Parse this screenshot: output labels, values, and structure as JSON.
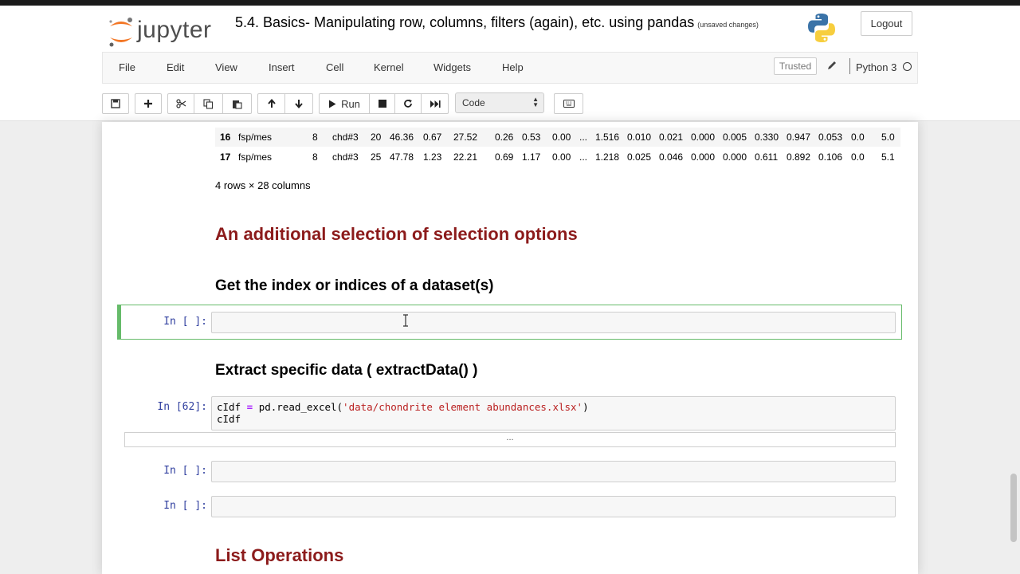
{
  "app": {
    "logo_text": "jupyter",
    "notebook_title": "5.4. Basics- Manipulating row, columns, filters (again), etc. using pandas",
    "save_status": "(unsaved changes)",
    "logout_label": "Logout"
  },
  "menu": {
    "items": [
      "File",
      "Edit",
      "View",
      "Insert",
      "Cell",
      "Kernel",
      "Widgets",
      "Help"
    ],
    "trusted_label": "Trusted",
    "kernel_name": "Python 3"
  },
  "toolbar": {
    "run_label": "Run",
    "cell_type": "Code"
  },
  "dataframe": {
    "rows": [
      [
        "16",
        "fsp/mes",
        "8",
        "chd#3",
        "20",
        "46.36",
        "0.67",
        "27.52",
        "0.26",
        "0.53",
        "0.00",
        "...",
        "1.516",
        "0.010",
        "0.021",
        "0.000",
        "0.005",
        "0.330",
        "0.947",
        "0.053",
        "0.0",
        "5.0"
      ],
      [
        "17",
        "fsp/mes",
        "8",
        "chd#3",
        "25",
        "47.78",
        "1.23",
        "22.21",
        "0.69",
        "1.17",
        "0.00",
        "...",
        "1.218",
        "0.025",
        "0.046",
        "0.000",
        "0.000",
        "0.611",
        "0.892",
        "0.106",
        "0.0",
        "5.1"
      ]
    ],
    "shape_text": "4 rows × 28 columns"
  },
  "cells": {
    "heading_selection": "An additional selection of selection options",
    "heading_index": "Get the index or indices of a dataset(s)",
    "prompt_empty": "In [ ]:",
    "heading_extract": "Extract specific data ( extractData() )",
    "prompt_62": "In [62]:",
    "code_62_var": "cIdf",
    "code_62_eq": " = ",
    "code_62_call": "pd.read_excel(",
    "code_62_str": "'data/chondrite element abundances.xlsx'",
    "code_62_close": ")",
    "code_62_line2": "cIdf",
    "output_collapsed": "...",
    "heading_list_ops": "List Operations"
  }
}
